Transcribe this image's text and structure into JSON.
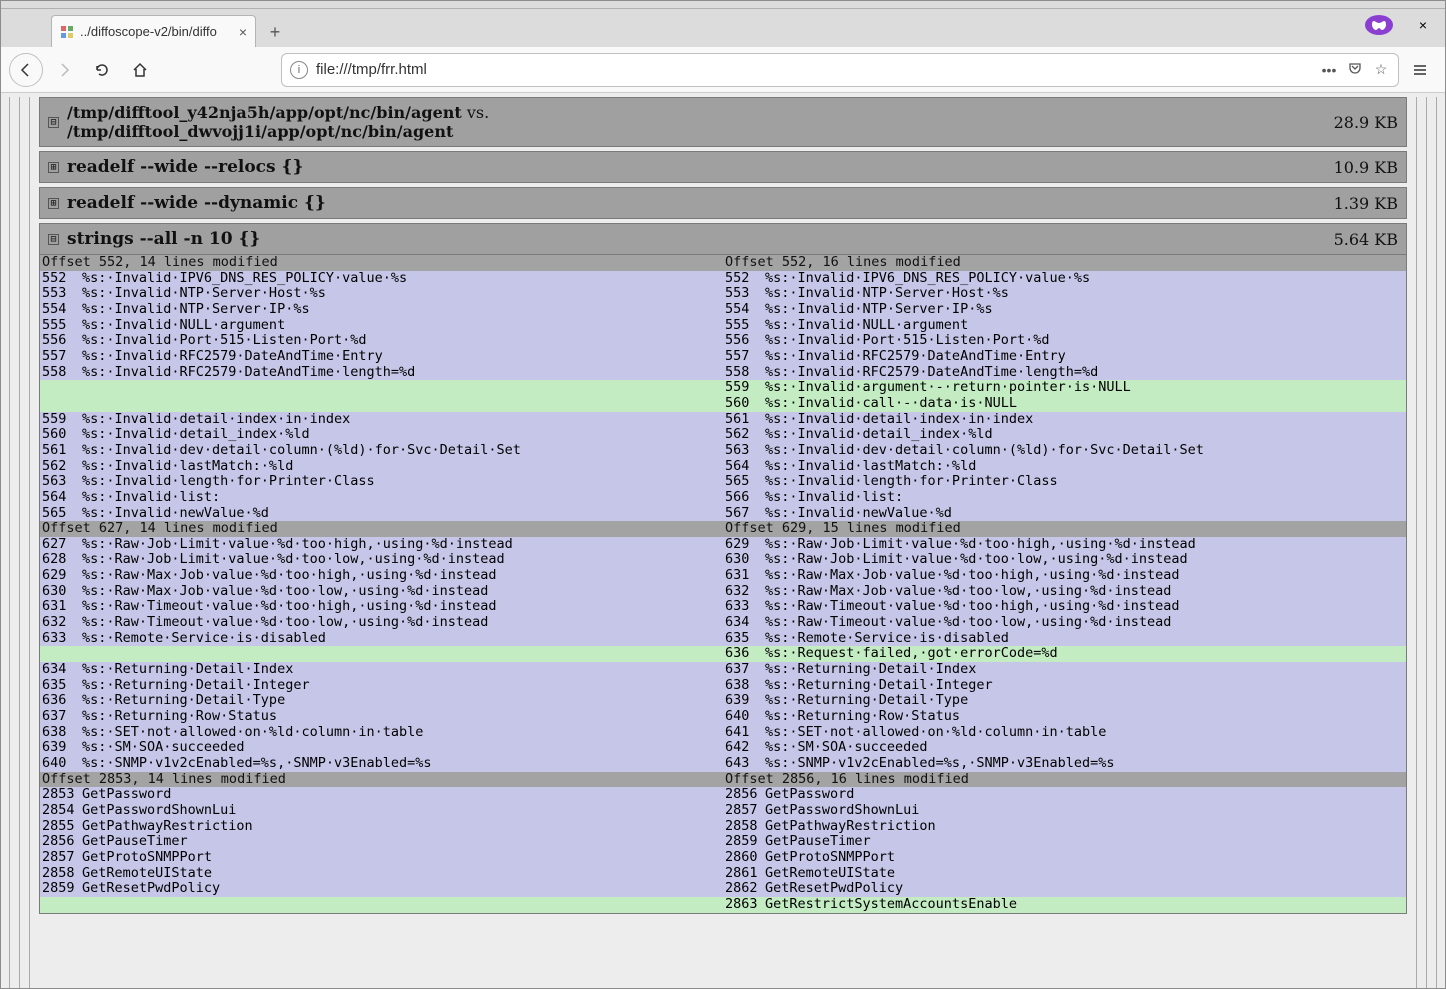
{
  "browser": {
    "tab_title": "../diffoscope-v2/bin/diffo",
    "url": "file:///tmp/frr.html"
  },
  "header": {
    "path_a": "/tmp/difftool_y42nja5h/app/opt/nc/bin/agent",
    "path_b": "/tmp/difftool_dwvojj1i/app/opt/nc/bin/agent",
    "vs": " vs.",
    "size": "28.9 KB"
  },
  "sections": [
    {
      "label": "readelf --wide --relocs {}",
      "size": "10.9 KB",
      "expanded": false
    },
    {
      "label": "readelf --wide --dynamic {}",
      "size": "1.39 KB",
      "expanded": false
    },
    {
      "label": "strings --all -n 10 {}",
      "size": "5.64 KB",
      "expanded": true
    }
  ],
  "hunks": [
    {
      "left_hdr": "Offset 552, 14 lines modified",
      "right_hdr": "Offset 552, 16 lines modified",
      "rows": [
        {
          "t": "ctx",
          "l": "552",
          "lt": "%s:·Invalid·IPV6_DNS_RES_POLICY·value·%s",
          "r": "552",
          "rt": "%s:·Invalid·IPV6_DNS_RES_POLICY·value·%s"
        },
        {
          "t": "ctx",
          "l": "553",
          "lt": "%s:·Invalid·NTP·Server·Host·%s",
          "r": "553",
          "rt": "%s:·Invalid·NTP·Server·Host·%s"
        },
        {
          "t": "ctx",
          "l": "554",
          "lt": "%s:·Invalid·NTP·Server·IP·%s",
          "r": "554",
          "rt": "%s:·Invalid·NTP·Server·IP·%s"
        },
        {
          "t": "ctx",
          "l": "555",
          "lt": "%s:·Invalid·NULL·argument",
          "r": "555",
          "rt": "%s:·Invalid·NULL·argument"
        },
        {
          "t": "ctx",
          "l": "556",
          "lt": "%s:·Invalid·Port·515·Listen·Port·%d",
          "r": "556",
          "rt": "%s:·Invalid·Port·515·Listen·Port·%d"
        },
        {
          "t": "ctx",
          "l": "557",
          "lt": "%s:·Invalid·RFC2579·DateAndTime·Entry",
          "r": "557",
          "rt": "%s:·Invalid·RFC2579·DateAndTime·Entry"
        },
        {
          "t": "ctx",
          "l": "558",
          "lt": "%s:·Invalid·RFC2579·DateAndTime·length=%d",
          "r": "558",
          "rt": "%s:·Invalid·RFC2579·DateAndTime·length=%d"
        },
        {
          "t": "add",
          "l": "",
          "lt": "",
          "r": "559",
          "rt": "%s:·Invalid·argument·-·return·pointer·is·NULL"
        },
        {
          "t": "add",
          "l": "",
          "lt": "",
          "r": "560",
          "rt": "%s:·Invalid·call·-·data·is·NULL"
        },
        {
          "t": "ctx",
          "l": "559",
          "lt": "%s:·Invalid·detail·index·in·index",
          "r": "561",
          "rt": "%s:·Invalid·detail·index·in·index"
        },
        {
          "t": "ctx",
          "l": "560",
          "lt": "%s:·Invalid·detail_index·%ld",
          "r": "562",
          "rt": "%s:·Invalid·detail_index·%ld"
        },
        {
          "t": "ctx",
          "l": "561",
          "lt": "%s:·Invalid·dev·detail·column·(%ld)·for·Svc·Detail·Set",
          "r": "563",
          "rt": "%s:·Invalid·dev·detail·column·(%ld)·for·Svc·Detail·Set"
        },
        {
          "t": "ctx",
          "l": "562",
          "lt": "%s:·Invalid·lastMatch:·%ld",
          "r": "564",
          "rt": "%s:·Invalid·lastMatch:·%ld"
        },
        {
          "t": "ctx",
          "l": "563",
          "lt": "%s:·Invalid·length·for·Printer·Class",
          "r": "565",
          "rt": "%s:·Invalid·length·for·Printer·Class"
        },
        {
          "t": "ctx",
          "l": "564",
          "lt": "%s:·Invalid·list:",
          "r": "566",
          "rt": "%s:·Invalid·list:"
        },
        {
          "t": "ctx",
          "l": "565",
          "lt": "%s:·Invalid·newValue·%d",
          "r": "567",
          "rt": "%s:·Invalid·newValue·%d"
        }
      ]
    },
    {
      "left_hdr": "Offset 627, 14 lines modified",
      "right_hdr": "Offset 629, 15 lines modified",
      "rows": [
        {
          "t": "ctx",
          "l": "627",
          "lt": "%s:·Raw·Job·Limit·value·%d·too·high,·using·%d·instead",
          "r": "629",
          "rt": "%s:·Raw·Job·Limit·value·%d·too·high,·using·%d·instead"
        },
        {
          "t": "ctx",
          "l": "628",
          "lt": "%s:·Raw·Job·Limit·value·%d·too·low,·using·%d·instead",
          "r": "630",
          "rt": "%s:·Raw·Job·Limit·value·%d·too·low,·using·%d·instead"
        },
        {
          "t": "ctx",
          "l": "629",
          "lt": "%s:·Raw·Max·Job·value·%d·too·high,·using·%d·instead",
          "r": "631",
          "rt": "%s:·Raw·Max·Job·value·%d·too·high,·using·%d·instead"
        },
        {
          "t": "ctx",
          "l": "630",
          "lt": "%s:·Raw·Max·Job·value·%d·too·low,·using·%d·instead",
          "r": "632",
          "rt": "%s:·Raw·Max·Job·value·%d·too·low,·using·%d·instead"
        },
        {
          "t": "ctx",
          "l": "631",
          "lt": "%s:·Raw·Timeout·value·%d·too·high,·using·%d·instead",
          "r": "633",
          "rt": "%s:·Raw·Timeout·value·%d·too·high,·using·%d·instead"
        },
        {
          "t": "ctx",
          "l": "632",
          "lt": "%s:·Raw·Timeout·value·%d·too·low,·using·%d·instead",
          "r": "634",
          "rt": "%s:·Raw·Timeout·value·%d·too·low,·using·%d·instead"
        },
        {
          "t": "ctx",
          "l": "633",
          "lt": "%s:·Remote·Service·is·disabled",
          "r": "635",
          "rt": "%s:·Remote·Service·is·disabled"
        },
        {
          "t": "add",
          "l": "",
          "lt": "",
          "r": "636",
          "rt": "%s:·Request·failed,·got·errorCode=%d"
        },
        {
          "t": "ctx",
          "l": "634",
          "lt": "%s:·Returning·Detail·Index",
          "r": "637",
          "rt": "%s:·Returning·Detail·Index"
        },
        {
          "t": "ctx",
          "l": "635",
          "lt": "%s:·Returning·Detail·Integer",
          "r": "638",
          "rt": "%s:·Returning·Detail·Integer"
        },
        {
          "t": "ctx",
          "l": "636",
          "lt": "%s:·Returning·Detail·Type",
          "r": "639",
          "rt": "%s:·Returning·Detail·Type"
        },
        {
          "t": "ctx",
          "l": "637",
          "lt": "%s:·Returning·Row·Status",
          "r": "640",
          "rt": "%s:·Returning·Row·Status"
        },
        {
          "t": "ctx",
          "l": "638",
          "lt": "%s:·SET·not·allowed·on·%ld·column·in·table",
          "r": "641",
          "rt": "%s:·SET·not·allowed·on·%ld·column·in·table"
        },
        {
          "t": "ctx",
          "l": "639",
          "lt": "%s:·SM·SOA·succeeded",
          "r": "642",
          "rt": "%s:·SM·SOA·succeeded"
        },
        {
          "t": "ctx",
          "l": "640",
          "lt": "%s:·SNMP·v1v2cEnabled=%s,·SNMP·v3Enabled=%s",
          "r": "643",
          "rt": "%s:·SNMP·v1v2cEnabled=%s,·SNMP·v3Enabled=%s"
        }
      ]
    },
    {
      "left_hdr": "Offset 2853, 14 lines modified",
      "right_hdr": "Offset 2856, 16 lines modified",
      "rows": [
        {
          "t": "ctx",
          "l": "2853",
          "lt": "GetPassword",
          "r": "2856",
          "rt": "GetPassword"
        },
        {
          "t": "ctx",
          "l": "2854",
          "lt": "GetPasswordShownLui",
          "r": "2857",
          "rt": "GetPasswordShownLui"
        },
        {
          "t": "ctx",
          "l": "2855",
          "lt": "GetPathwayRestriction",
          "r": "2858",
          "rt": "GetPathwayRestriction"
        },
        {
          "t": "ctx",
          "l": "2856",
          "lt": "GetPauseTimer",
          "r": "2859",
          "rt": "GetPauseTimer"
        },
        {
          "t": "ctx",
          "l": "2857",
          "lt": "GetProtoSNMPPort",
          "r": "2860",
          "rt": "GetProtoSNMPPort"
        },
        {
          "t": "ctx",
          "l": "2858",
          "lt": "GetRemoteUIState",
          "r": "2861",
          "rt": "GetRemoteUIState"
        },
        {
          "t": "ctx",
          "l": "2859",
          "lt": "GetResetPwdPolicy",
          "r": "2862",
          "rt": "GetResetPwdPolicy"
        },
        {
          "t": "add",
          "l": "",
          "lt": "",
          "r": "2863",
          "rt": "GetRestrictSystemAccountsEnable"
        }
      ]
    }
  ]
}
